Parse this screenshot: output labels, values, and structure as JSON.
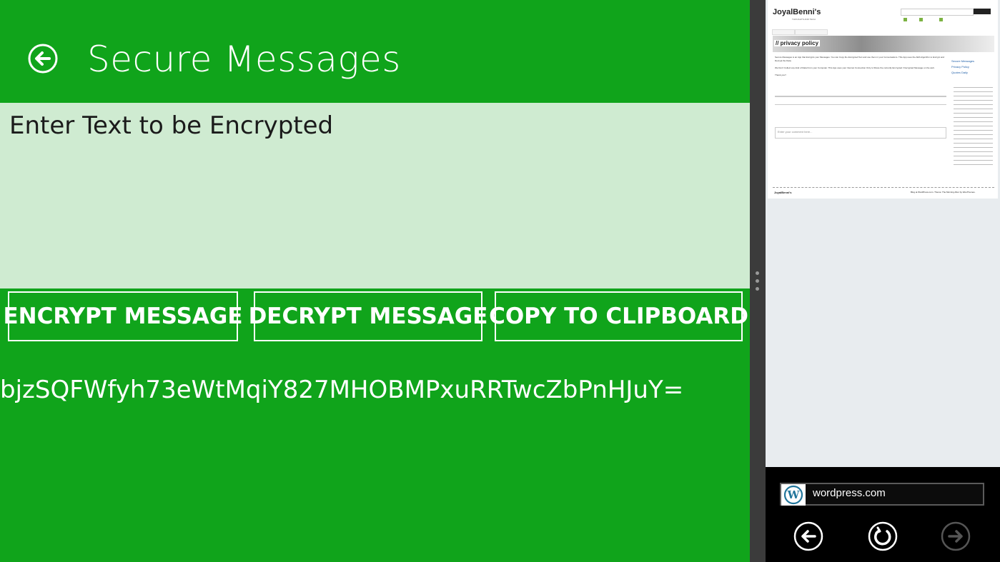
{
  "app": {
    "title": "Secure Messages",
    "input_placeholder": "Enter Text to be Encrypted",
    "buttons": {
      "encrypt": "ENCRYPT MESSAGE",
      "decrypt": "DECRYPT MESSAGE",
      "copy": "COPY TO CLIPBOARD"
    },
    "output": "bjzSQFWfyh73eWtMqiY827MHOBMPxuRRTwcZbPnHJuY="
  },
  "browser": {
    "thumbnail": {
      "site_name": "JoyalBenni's",
      "tagline": "THOUGHTS AND TECH",
      "banner_title": "// privacy policy",
      "body": [
        "Secure Messages is an App that Encrypts your Messages. You can Copy the Encrypted Text and use them in your Conversations. This App uses the AES Algorithm to Encrypt and Decrypt the Data.",
        "We Don't Collect any kind of Data From your Computer. This App uses your Internet Connection Only to Share the currently Encrypted / Decrypted Message on the web.",
        "Thank you!!"
      ],
      "comment_placeholder": "Enter your comment here...",
      "sidebar_links": [
        "Secure Messages",
        "Privacy Policy",
        "Quotes Daily"
      ],
      "footer_left": "JoyalBenni's",
      "footer_right": "Blog at WordPress.com. Theme: The Morning After by WooThemes."
    },
    "address": "wordpress.com",
    "nav": {
      "back_icon": "back-arrow-icon",
      "refresh_icon": "refresh-icon",
      "forward_icon": "forward-arrow-icon"
    }
  },
  "colors": {
    "app_green": "#10a41b",
    "input_bg": "#cfebd1",
    "splitter": "#3b3b3b",
    "browser_bg": "#e8ecef"
  }
}
